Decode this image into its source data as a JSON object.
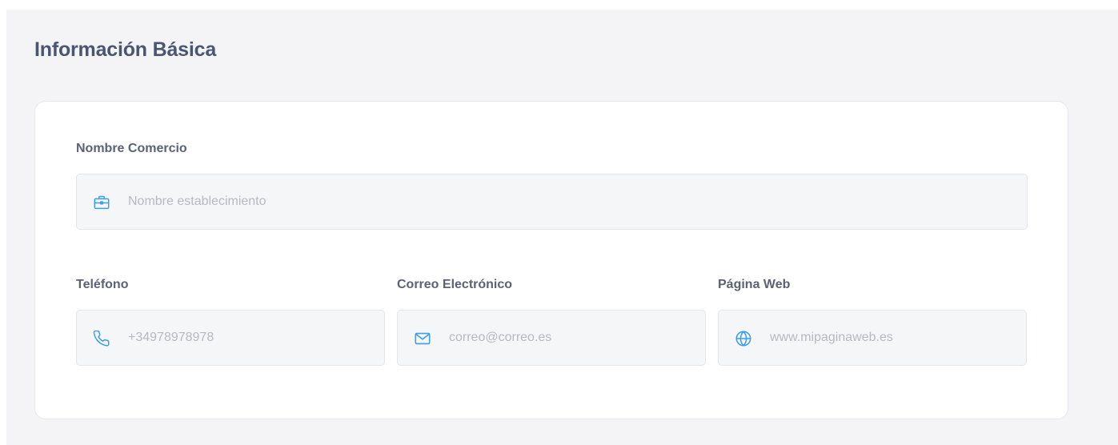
{
  "section": {
    "title": "Información Básica"
  },
  "fields": {
    "business_name": {
      "label": "Nombre Comercio",
      "placeholder": "Nombre establecimiento",
      "icon": "briefcase-icon"
    },
    "phone": {
      "label": "Teléfono",
      "placeholder": "+34978978978",
      "icon": "phone-icon"
    },
    "email": {
      "label": "Correo Electrónico",
      "placeholder": "correo@correo.es",
      "icon": "envelope-icon"
    },
    "website": {
      "label": "Página Web",
      "placeholder": "www.mipaginaweb.es",
      "icon": "globe-icon"
    }
  },
  "colors": {
    "accent": "#3a9eea",
    "title": "#4a5572",
    "label": "#5b6275",
    "placeholder": "#b6b9c1",
    "panel_background": "#f4f4f6",
    "field_background": "#f5f6f8"
  }
}
